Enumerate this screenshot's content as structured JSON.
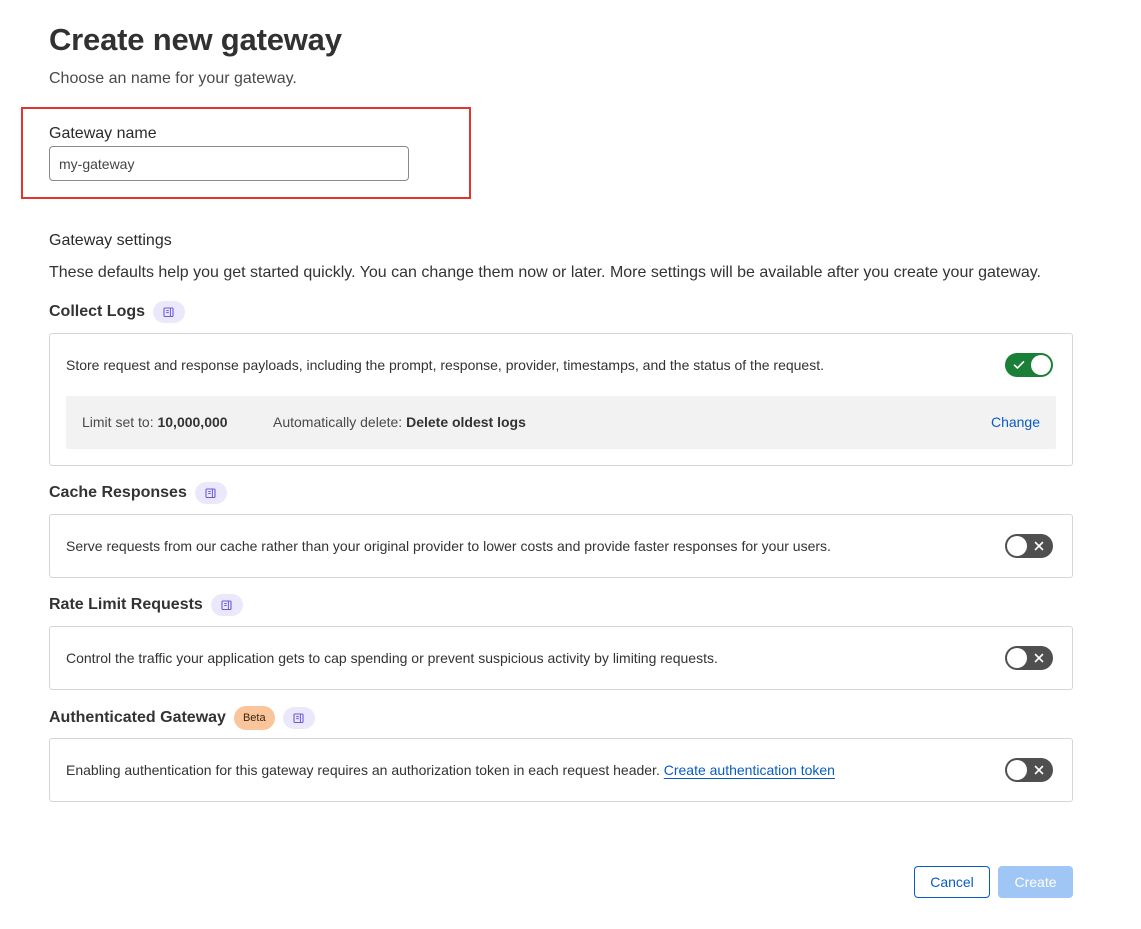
{
  "page": {
    "title": "Create new gateway",
    "subtitle": "Choose an name for your gateway."
  },
  "gateway_name": {
    "label": "Gateway name",
    "value": "my-gateway"
  },
  "settings": {
    "title": "Gateway settings",
    "description": "These defaults help you get started quickly. You can change them now or later. More settings will be available after you create your gateway."
  },
  "sections": {
    "collect_logs": {
      "title": "Collect Logs",
      "doc_icon": "book-icon",
      "description": "Store request and response payloads, including the prompt, response, provider, timestamps, and the status of the request.",
      "enabled": true,
      "limit_label": "Limit set to:",
      "limit_value": "10,000,000",
      "delete_label": "Automatically delete:",
      "delete_value": "Delete oldest logs",
      "change_label": "Change"
    },
    "cache_responses": {
      "title": "Cache Responses",
      "doc_icon": "book-icon",
      "description": "Serve requests from our cache rather than your original provider to lower costs and provide faster responses for your users.",
      "enabled": false
    },
    "rate_limit": {
      "title": "Rate Limit Requests",
      "doc_icon": "book-icon",
      "description": "Control the traffic your application gets to cap spending or prevent suspicious activity by limiting requests.",
      "enabled": false
    },
    "authenticated": {
      "title": "Authenticated Gateway",
      "badge": "Beta",
      "doc_icon": "book-icon",
      "description": "Enabling authentication for this gateway requires an authorization token in each request header.",
      "link_label": "Create authentication token",
      "enabled": false
    }
  },
  "actions": {
    "cancel_label": "Cancel",
    "create_label": "Create"
  },
  "colors": {
    "toggle_on": "#1a7f37",
    "toggle_off": "#4f4f4f",
    "link": "#0a5cc2",
    "highlight": "#e3352f",
    "beta_badge": "#fbc59b",
    "doc_pill": "#ece8fb"
  }
}
